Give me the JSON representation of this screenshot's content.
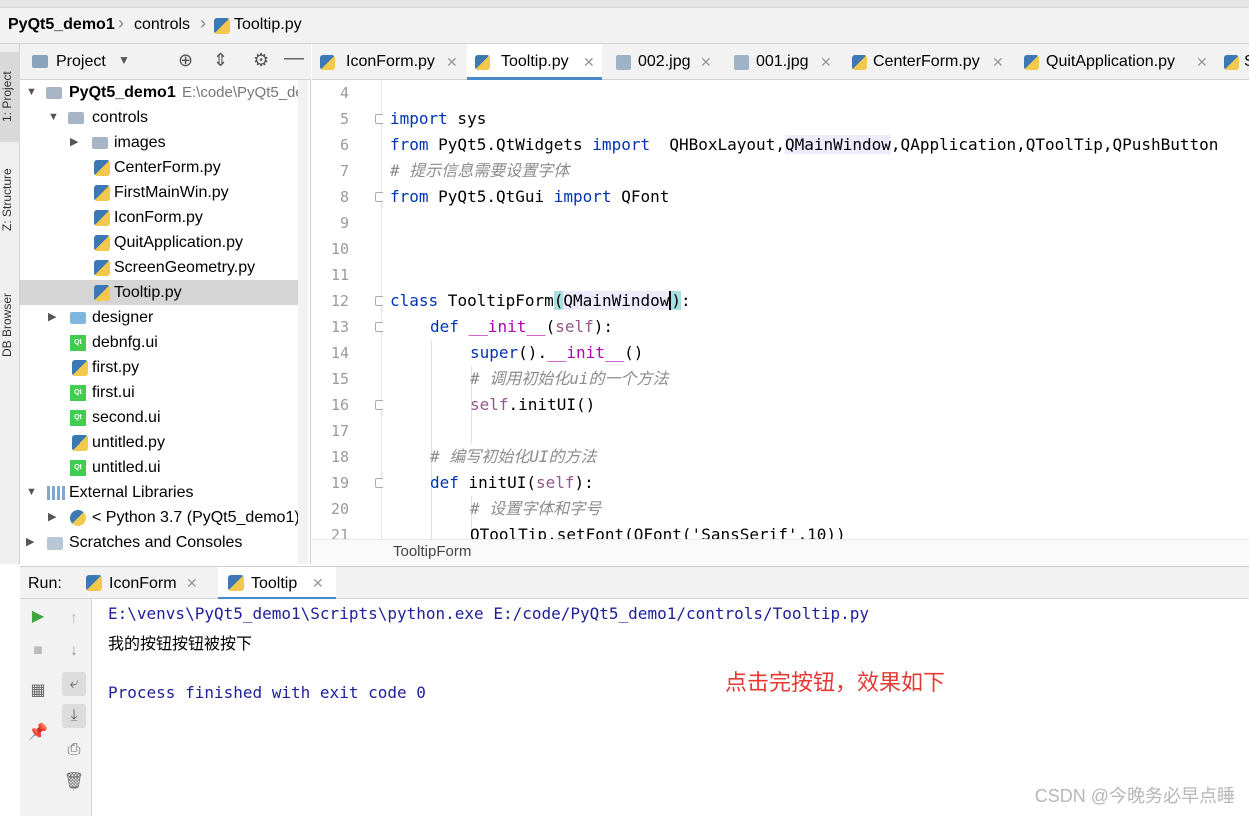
{
  "breadcrumb": [
    "PyQt5_demo1",
    "controls",
    "Tooltip.py"
  ],
  "left_strip": {
    "tab1": "1: Project",
    "tab2": "Z: Structure",
    "tab3": "DB Browser"
  },
  "project_panel": {
    "title": "Project",
    "items": [
      {
        "label": "PyQt5_demo1",
        "suffix": "E:\\code\\PyQt5_de",
        "icon": "folder-icon"
      },
      {
        "label": "controls",
        "icon": "folder-icon"
      },
      {
        "label": "images",
        "icon": "folder-icon"
      },
      {
        "label": "CenterForm.py",
        "icon": "python-file-icon"
      },
      {
        "label": "FirstMainWin.py",
        "icon": "python-file-icon"
      },
      {
        "label": "IconForm.py",
        "icon": "python-file-icon"
      },
      {
        "label": "QuitApplication.py",
        "icon": "python-file-icon"
      },
      {
        "label": "ScreenGeometry.py",
        "icon": "python-file-icon"
      },
      {
        "label": "Tooltip.py",
        "icon": "python-file-icon",
        "selected": true
      },
      {
        "label": "designer",
        "icon": "folder-icon"
      },
      {
        "label": "debnfg.ui",
        "icon": "qt-ui-file-icon"
      },
      {
        "label": "first.py",
        "icon": "python-file-icon"
      },
      {
        "label": "first.ui",
        "icon": "qt-ui-file-icon"
      },
      {
        "label": "second.ui",
        "icon": "qt-ui-file-icon"
      },
      {
        "label": "untitled.py",
        "icon": "python-file-icon"
      },
      {
        "label": "untitled.ui",
        "icon": "qt-ui-file-icon"
      },
      {
        "label": "External Libraries",
        "icon": "library-icon"
      },
      {
        "label": "< Python 3.7 (PyQt5_demo1) >",
        "icon": "python-icon"
      },
      {
        "label": "Scratches and Consoles",
        "icon": "scratches-icon"
      }
    ]
  },
  "editor_tabs": [
    "IconForm.py",
    "Tooltip.py",
    "002.jpg",
    "001.jpg",
    "CenterForm.py",
    "QuitApplication.py",
    "S"
  ],
  "line_numbers": [
    "4",
    "5",
    "6",
    "7",
    "8",
    "9",
    "10",
    "11",
    "12",
    "13",
    "14",
    "15",
    "16",
    "17",
    "18",
    "19",
    "20",
    "21"
  ],
  "code": {
    "l5_kw": "import",
    "l5_rest": " sys",
    "l6_kw1": "from",
    "l6_mod": " PyQt5.QtWidgets ",
    "l6_kw2": "import",
    "l6_a": "  QHBoxLayout,",
    "l6_b": "QMainWindow",
    "l6_c": ",QApplication,QToolTip,QPushButton",
    "l7": "# 提示信息需要设置字体",
    "l8_kw1": "from",
    "l8_mod": " PyQt5.QtGui ",
    "l8_kw2": "import",
    "l8_rest": " QFont",
    "l12_kw": "class",
    "l12_name": " TooltipForm",
    "l12_p1": "(",
    "l12_base": "QMainWindow",
    "l12_p2": ")",
    "l12_end": ":",
    "l13_kw": "def",
    "l13_name": " __init__",
    "l13_p": "(",
    "l13_self": "self",
    "l13_end": "):",
    "l14_a": "super",
    "l14_b": "().",
    "l14_c": "__init__",
    "l14_d": "()",
    "l15": "# 调用初始化ui的一个方法",
    "l16_self": "self",
    "l16_rest": ".initUI()",
    "l18": "# 编写初始化UI的方法",
    "l19_kw": "def",
    "l19_name": " initUI",
    "l19_p": "(",
    "l19_self": "self",
    "l19_end": "):",
    "l20": "# 设置字体和字号",
    "l21": "QToolTip.setFont(QFont('SansSerif',10))"
  },
  "editor_breadcrumb": "TooltipForm",
  "run_panel": {
    "label": "Run:",
    "tabs": [
      "IconForm",
      "Tooltip"
    ],
    "output": [
      "E:\\venvs\\PyQt5_demo1\\Scripts\\python.exe E:/code/PyQt5_demo1/controls/Tooltip.py",
      "我的按钮按钮被按下",
      "Process finished with exit code 0"
    ],
    "annotation": "点击完按钮，效果如下"
  },
  "watermark": "CSDN @今晚务必早点睡"
}
